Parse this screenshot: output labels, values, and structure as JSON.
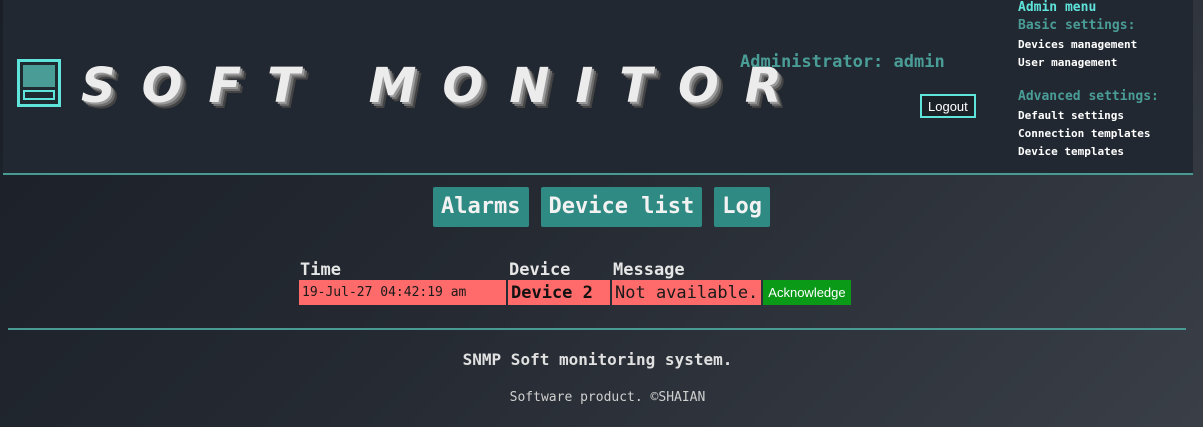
{
  "header": {
    "logo_text": "SOFT MONITOR",
    "admin_label": "Administrator: admin",
    "logout_label": "Logout"
  },
  "admin_menu": {
    "title": "Admin menu",
    "basic_title": "Basic settings:",
    "basic_items": [
      "Devices management",
      "User management"
    ],
    "advanced_title": "Advanced settings:",
    "advanced_items": [
      "Default settings",
      "Connection templates",
      "Device templates"
    ]
  },
  "nav": {
    "tabs": [
      "Alarms",
      "Device list",
      "Log"
    ]
  },
  "alarms": {
    "columns": [
      "Time",
      "Device",
      "Message"
    ],
    "rows": [
      {
        "time": "19-Jul-27 04:42:19 am",
        "device": "Device 2",
        "message": "Not available.",
        "action": "Acknowledge"
      }
    ]
  },
  "footer": {
    "title": "SNMP Soft monitoring system.",
    "copyright": "Software product. ©SHAIAN"
  },
  "colors": {
    "accent": "#5fe4dc",
    "accent_dark": "#4a9d97",
    "nav_button": "#2f8a84",
    "alarm_row": "#ff6a6a",
    "ack_button": "#0a9a17"
  }
}
